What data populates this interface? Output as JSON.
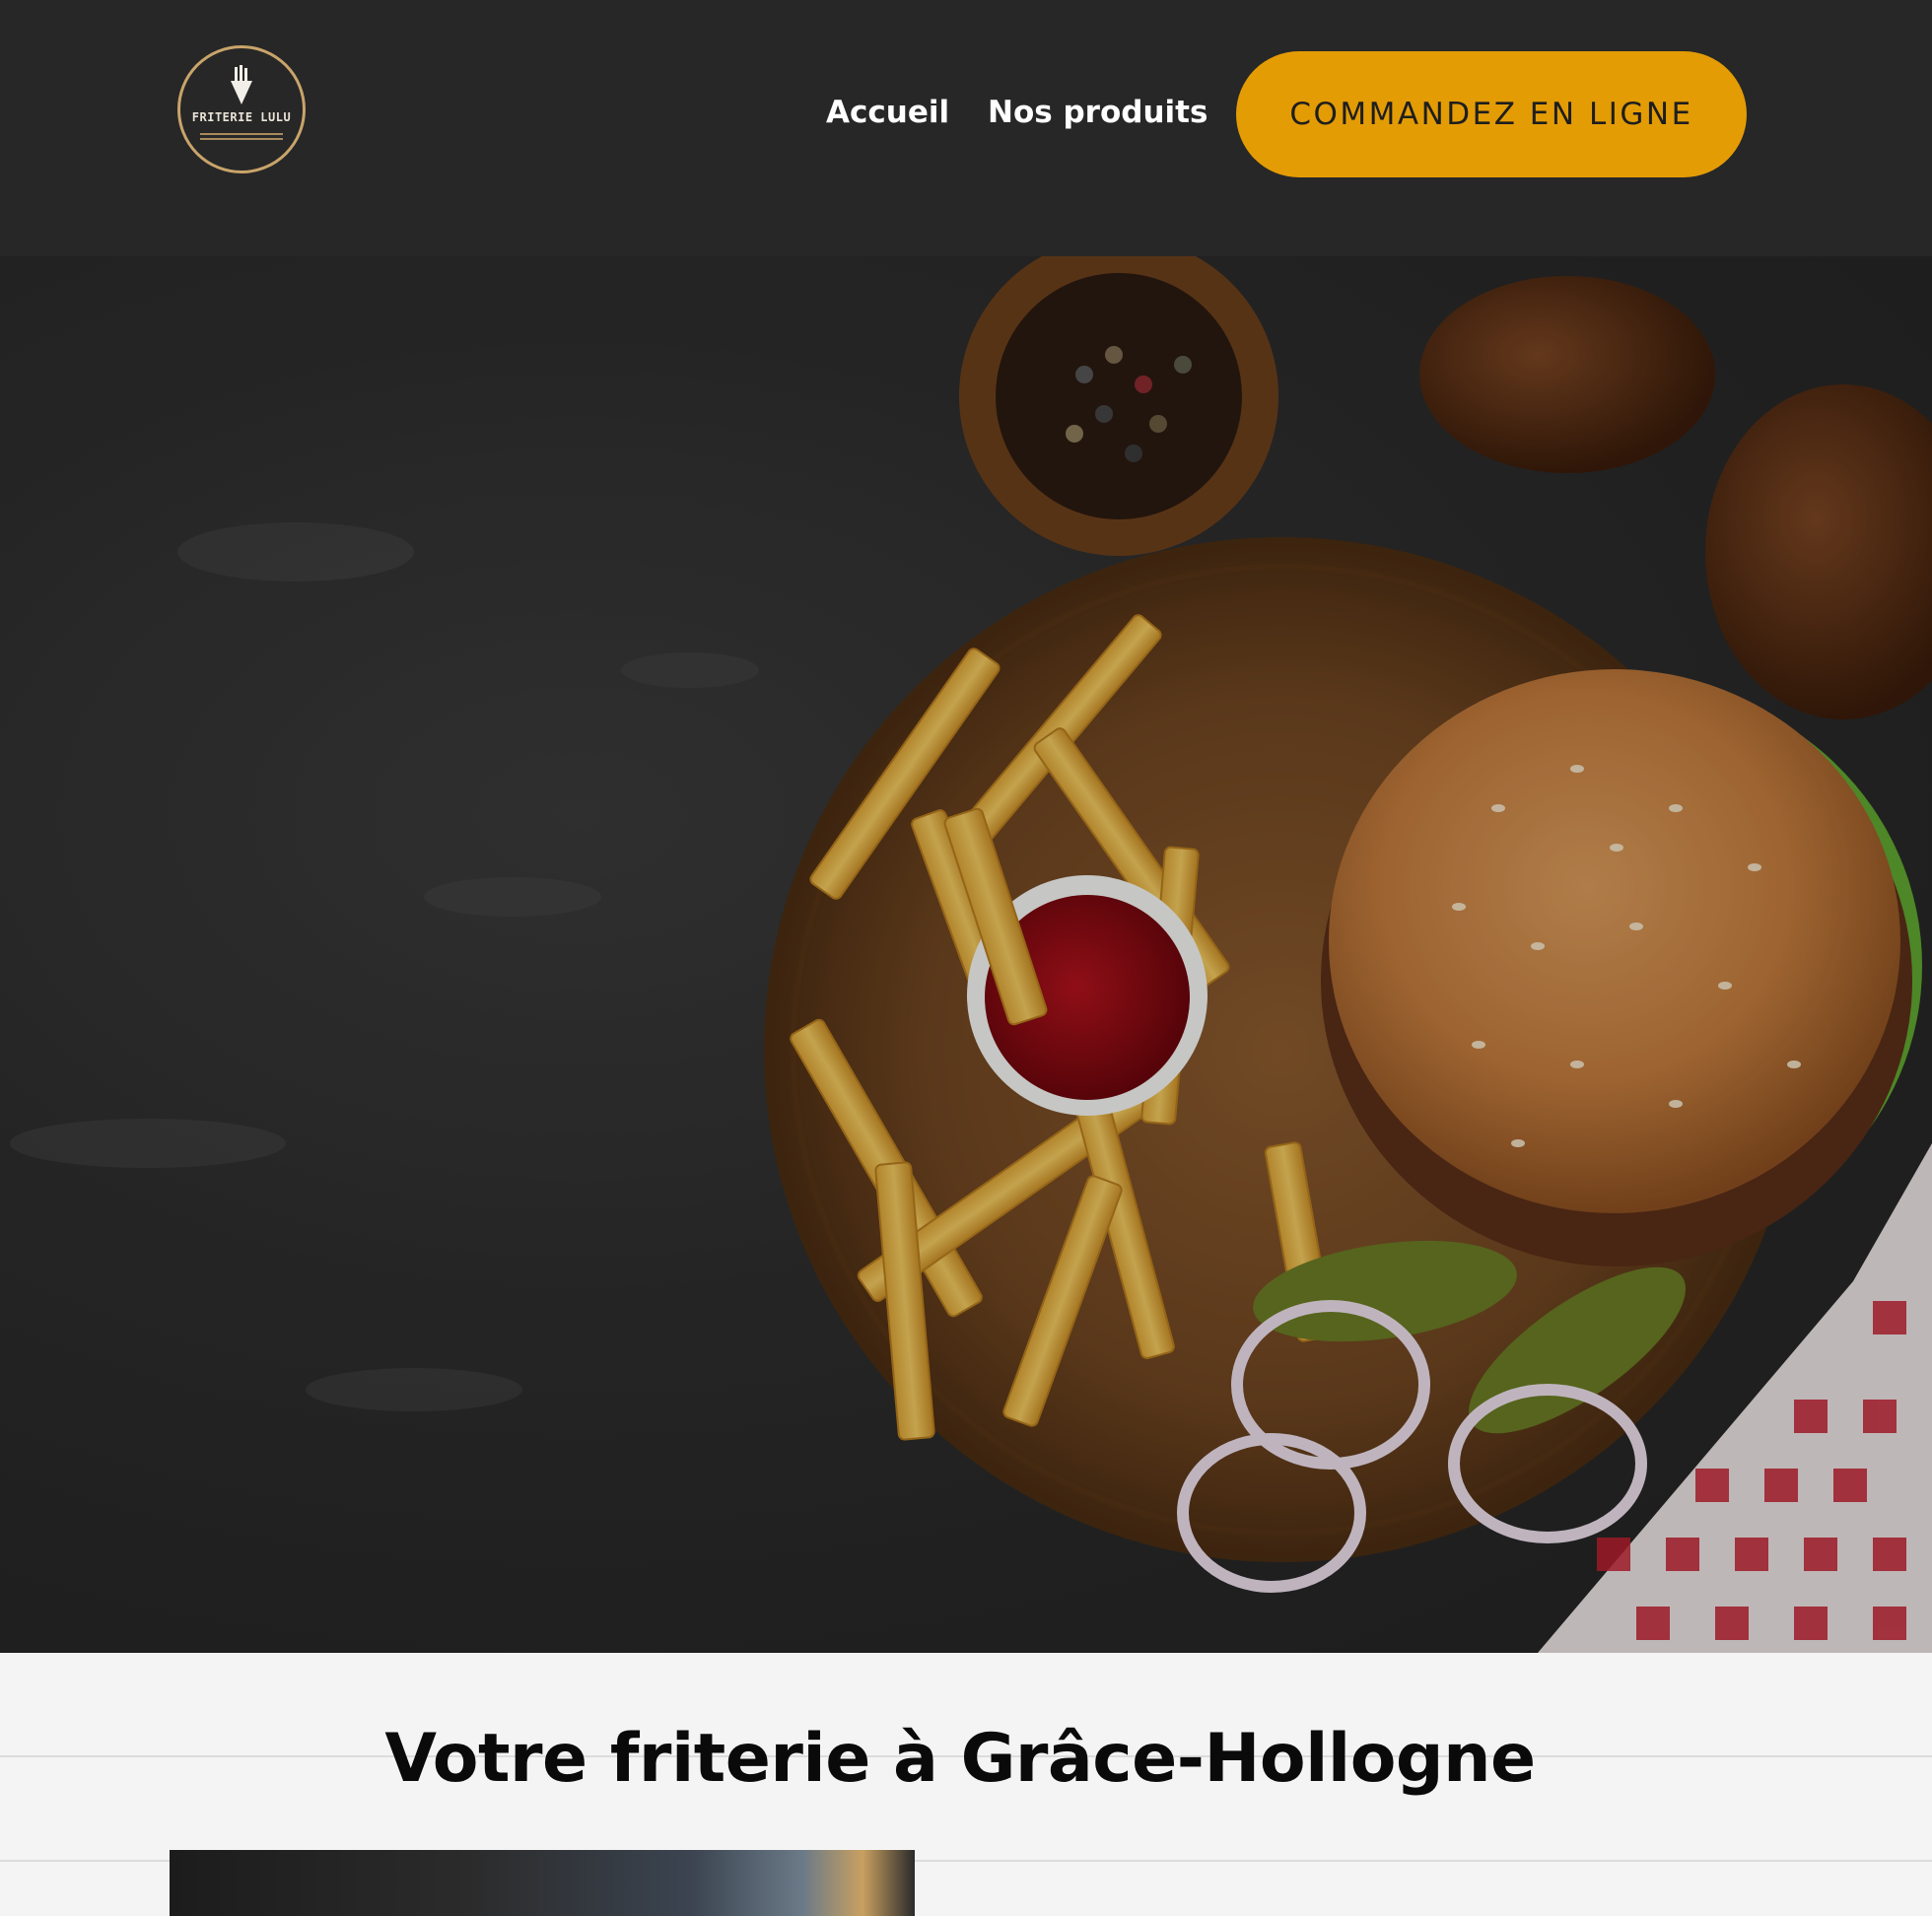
{
  "header": {
    "logo_text": "FRITERIE LULU",
    "nav": [
      {
        "label": "Accueil"
      },
      {
        "label": "Nos produits"
      }
    ],
    "cta_label": "COMMANDEZ EN LIGNE"
  },
  "hero": {
    "slides_count": 3,
    "active_slide": 1,
    "image_subject": "burger-fries-ketchup-platter"
  },
  "intro": {
    "title": "Votre friterie à Grâce-Hollogne"
  },
  "colors": {
    "header_bg": "#272727",
    "cta_bg": "#e49c05",
    "logo_gold": "#c9a46a",
    "hero_bg": "#2c2c2c"
  }
}
